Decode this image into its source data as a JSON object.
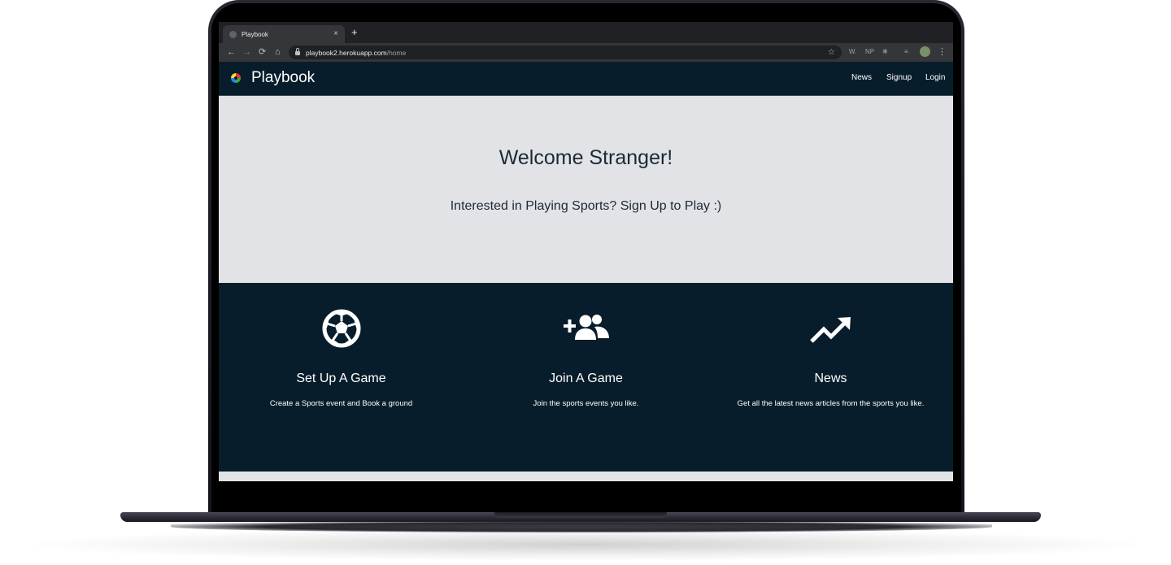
{
  "browser": {
    "tab_title": "Playbook",
    "tab_close": "×",
    "new_tab": "+",
    "url_host": "playbook2.herokuapp.com",
    "url_path": "/home",
    "back_icon": "←",
    "forward_icon": "→",
    "reload_icon": "⟳",
    "home_icon": "⌂",
    "star_icon": "☆",
    "extensions": [
      "W.",
      "NP",
      "❋",
      "≡"
    ],
    "menu_icon": "⋮"
  },
  "navbar": {
    "brand": "Playbook",
    "links": [
      "News",
      "Signup",
      "Login"
    ]
  },
  "hero": {
    "title": "Welcome Stranger!",
    "subtitle": "Interested in Playing Sports? Sign Up to Play :)"
  },
  "features": [
    {
      "icon": "soccer-ball-icon",
      "title": "Set Up A Game",
      "description": "Create a Sports event and Book a ground"
    },
    {
      "icon": "add-users-icon",
      "title": "Join A Game",
      "description": "Join the sports events you like."
    },
    {
      "icon": "trending-up-icon",
      "title": "News",
      "description": "Get all the latest news articles from the sports you like."
    }
  ],
  "colors": {
    "navbar_bg": "#081d2b",
    "hero_bg": "#e2e3e6",
    "text_dark": "#1b2a35",
    "text_light": "#ffffff"
  }
}
